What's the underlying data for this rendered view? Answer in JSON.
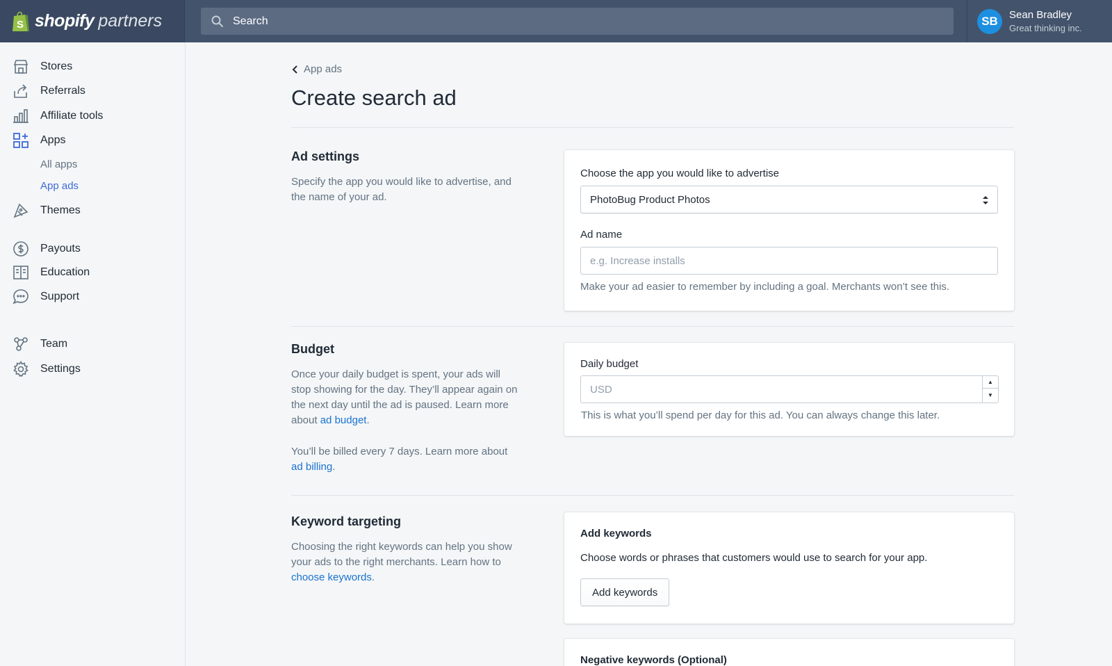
{
  "brand": {
    "name": "shopify",
    "suffix": "partners"
  },
  "search": {
    "placeholder": "Search"
  },
  "user": {
    "initials": "SB",
    "name": "Sean Bradley",
    "org": "Great thinking inc."
  },
  "sidebar": {
    "items": [
      {
        "label": "Stores",
        "icon": "store-icon"
      },
      {
        "label": "Referrals",
        "icon": "referral-icon"
      },
      {
        "label": "Affiliate tools",
        "icon": "bar-chart-icon"
      },
      {
        "label": "Apps",
        "icon": "apps-icon"
      },
      {
        "label": "Themes",
        "icon": "theme-icon"
      },
      {
        "label": "Payouts",
        "icon": "dollar-icon"
      },
      {
        "label": "Education",
        "icon": "book-icon"
      },
      {
        "label": "Support",
        "icon": "chat-icon"
      },
      {
        "label": "Team",
        "icon": "team-icon"
      },
      {
        "label": "Settings",
        "icon": "gear-icon"
      }
    ],
    "sub_items": [
      {
        "label": "All apps",
        "active": false
      },
      {
        "label": "App ads",
        "active": true
      }
    ]
  },
  "breadcrumb": {
    "label": "App ads"
  },
  "page": {
    "title": "Create search ad"
  },
  "ad_settings": {
    "title": "Ad settings",
    "description": "Specify the app you would like to advertise, and the name of your ad.",
    "app_label": "Choose the app you would like to advertise",
    "app_value": "PhotoBug Product Photos",
    "name_label": "Ad name",
    "name_placeholder": "e.g. Increase installs",
    "name_help": "Make your ad easier to remember by including a goal. Merchants won’t see this."
  },
  "budget": {
    "title": "Budget",
    "desc_pre": "Once your daily budget is spent, your ads will stop showing for the day. They’ll appear again on the next day until the ad is paused. Learn more about ",
    "desc_link": "ad budget",
    "desc_post": ".",
    "billing_pre": "You’ll be billed every 7 days. Learn more about ",
    "billing_link": "ad billing",
    "billing_post": ".",
    "field_label": "Daily budget",
    "placeholder": "USD",
    "help": "This is what you’ll spend per day for this ad. You can always change this later."
  },
  "keywords": {
    "title": "Keyword targeting",
    "desc_pre": "Choosing the right keywords can help you show your ads to the right merchants. Learn how to ",
    "desc_link": "choose keywords",
    "desc_post": ".",
    "add_heading": "Add keywords",
    "add_desc": "Choose words or phrases that customers would use to search for your app.",
    "add_button": "Add keywords",
    "negative_heading": "Negative keywords (Optional)"
  },
  "colors": {
    "topbar": "#43536b",
    "accent": "#3f6ad8",
    "link": "#1a73d0",
    "avatar": "#1d8fe0"
  }
}
